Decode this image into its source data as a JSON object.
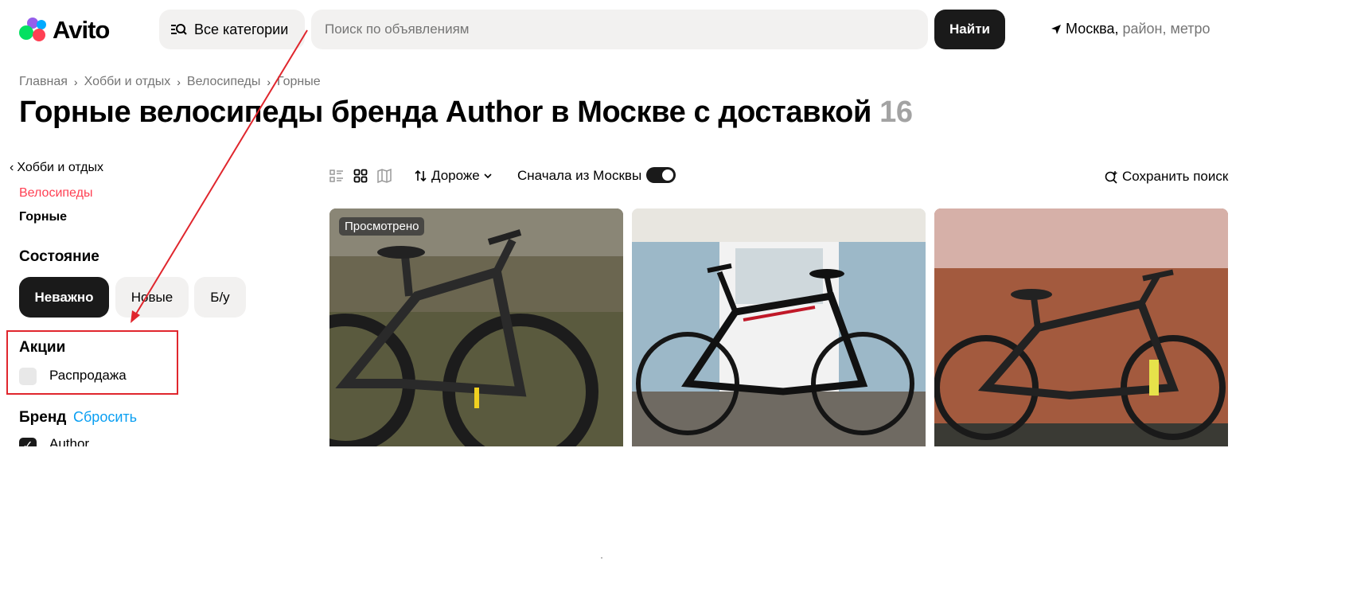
{
  "header": {
    "logo_text": "Avito",
    "categories_label": "Все категории",
    "search_placeholder": "Поиск по объявлениям",
    "find_label": "Найти",
    "location_city": "Москва,",
    "location_rest": "район, метро"
  },
  "breadcrumbs": [
    "Главная",
    "Хобби и отдых",
    "Велосипеды",
    "Горные"
  ],
  "page": {
    "title": "Горные велосипеды бренда Author в Москве с доставкой",
    "count": "16"
  },
  "sidebar": {
    "back_label": "Хобби и отдых",
    "category_label": "Велосипеды",
    "current_label": "Горные",
    "condition_heading": "Состояние",
    "condition_options": [
      "Неважно",
      "Новые",
      "Б/у"
    ],
    "condition_selected": "Неважно",
    "promo_heading": "Акции",
    "sale_label": "Распродажа",
    "brand_heading": "Бренд",
    "reset_label": "Сбросить",
    "brand_item": "Author"
  },
  "toolbar": {
    "sort_label": "Дороже",
    "moscow_first_label": "Сначала из Москвы",
    "save_search_label": "Сохранить поиск"
  },
  "listings": [
    {
      "badge": "Просмотрено"
    },
    {
      "badge": ""
    },
    {
      "badge": ""
    }
  ],
  "colors": {
    "accent_red": "#ff4053",
    "link_blue": "#0a9ff2",
    "dark": "#1a1a1a",
    "annotation_red": "#e0262d"
  },
  "icons": [
    "search-icon",
    "navigation-arrow-icon",
    "chevron-right-icon",
    "chevron-left-icon",
    "list-view-icon",
    "grid-view-icon",
    "map-view-icon",
    "sort-icon",
    "chevron-down-icon",
    "save-search-icon",
    "checkmark-icon"
  ]
}
